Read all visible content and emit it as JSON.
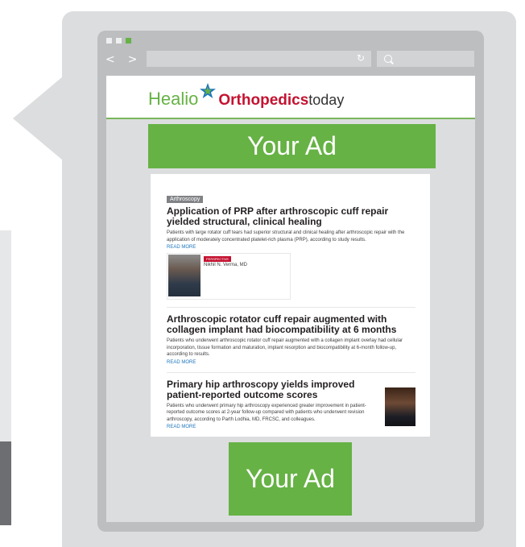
{
  "browser": {
    "nav_back": "<",
    "nav_forward": ">",
    "reload": "↻"
  },
  "logo": {
    "brand": "Healio",
    "publication_bold": "Orthopedics",
    "publication_light": "today"
  },
  "ads": {
    "top_label": "Your Ad",
    "bottom_label": "Your Ad"
  },
  "articles": [
    {
      "tag": "Arthroscopy",
      "headline": "Application of PRP after arthroscopic cuff repair yielded structural, clinical healing",
      "summary": "Patients with large rotator cuff tears had superior structural and clinical healing after arthroscopic repair with the application of moderately concentrated platelet-rich plasma (PRP), according to study results.",
      "read_more": "READ MORE",
      "author_badge": "PERSPECTIVE",
      "author_name": "Nikhil N. Verma, MD"
    },
    {
      "headline": "Arthroscopic rotator cuff repair augmented with collagen implant had biocompatibility at 6 months",
      "summary": "Patients who underwent arthroscopic rotator cuff repair augmented with a collagen implant overlay had cellular incorporation, tissue formation and maturation, implant resorption and biocompatibility at 6-month follow-up, according to results.",
      "read_more": "READ MORE"
    },
    {
      "headline": "Primary hip arthroscopy yields improved patient-reported outcome scores",
      "summary": "Patients who underwent primary hip arthroscopy experienced greater improvement in patient-reported outcome scores at 2-year follow-up compared with patients who underwent revision arthroscopy, according to Parth Lodhia, MD, FRCSC, and colleagues.",
      "read_more": "READ MORE"
    }
  ],
  "colors": {
    "accent_green": "#66b245",
    "brand_red": "#c41230",
    "link_blue": "#1c75bc"
  }
}
